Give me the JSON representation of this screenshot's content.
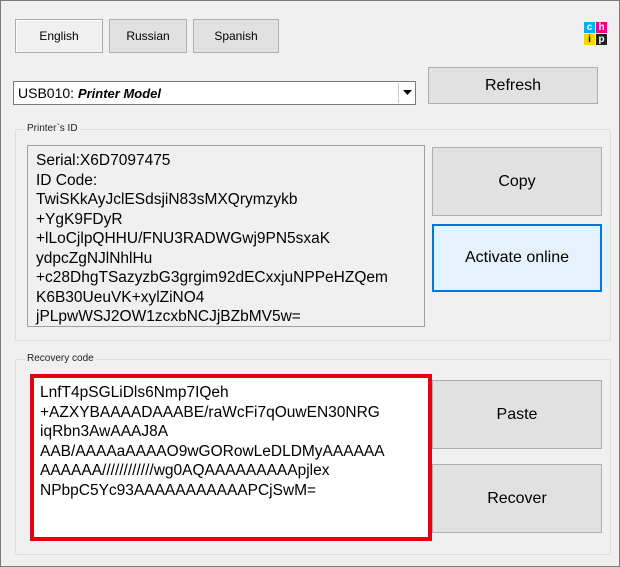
{
  "tabs": [
    {
      "label": "English",
      "active": true
    },
    {
      "label": "Russian",
      "active": false
    },
    {
      "label": "Spanish",
      "active": false
    }
  ],
  "logo": {
    "letters": [
      "c",
      "h",
      "i",
      "p"
    ],
    "colors": [
      "#00aeef",
      "#ec008c",
      "#ffd400",
      "#231f20"
    ]
  },
  "device_select": {
    "port": "USB010:",
    "model": "Printer Model"
  },
  "buttons": {
    "refresh": "Refresh",
    "copy": "Copy",
    "activate": "Activate online",
    "paste": "Paste",
    "recover": "Recover"
  },
  "printer_id": {
    "group_label": "Printer`s ID",
    "lines": [
      "Serial:X6D7097475",
      "ID Code:",
      "TwiSKkAyJclESdsjiN83sMXQrymzykb",
      "+YgK9FDyR",
      "+lLoCjlpQHHU/FNU3RADWGwj9PN5sxaK",
      "ydpcZgNJlNhlHu",
      "+c28DhgTSazyzbG3grgim92dECxxjuNPPeHZQem",
      "K6B30UeuVK+xylZiNO4",
      "jPLpwWSJ2OW1zcxbNCJjBZbMV5w="
    ]
  },
  "recovery": {
    "group_label": "Recovery code",
    "lines": [
      "LnfT4pSGLiDls6Nmp7IQeh",
      "+AZXYBAAAADAAABE/raWcFi7qOuwEN30NRG",
      "iqRbn3AwAAAJ8A",
      "AAB/AAAAaAAAAO9wGORowLeDLDMyAAAAAA",
      "AAAAAA////////////wg0AQAAAAAAAAApjlex",
      "NPbpC5Yc93AAAAAAAAAAAPCjSwM="
    ]
  }
}
